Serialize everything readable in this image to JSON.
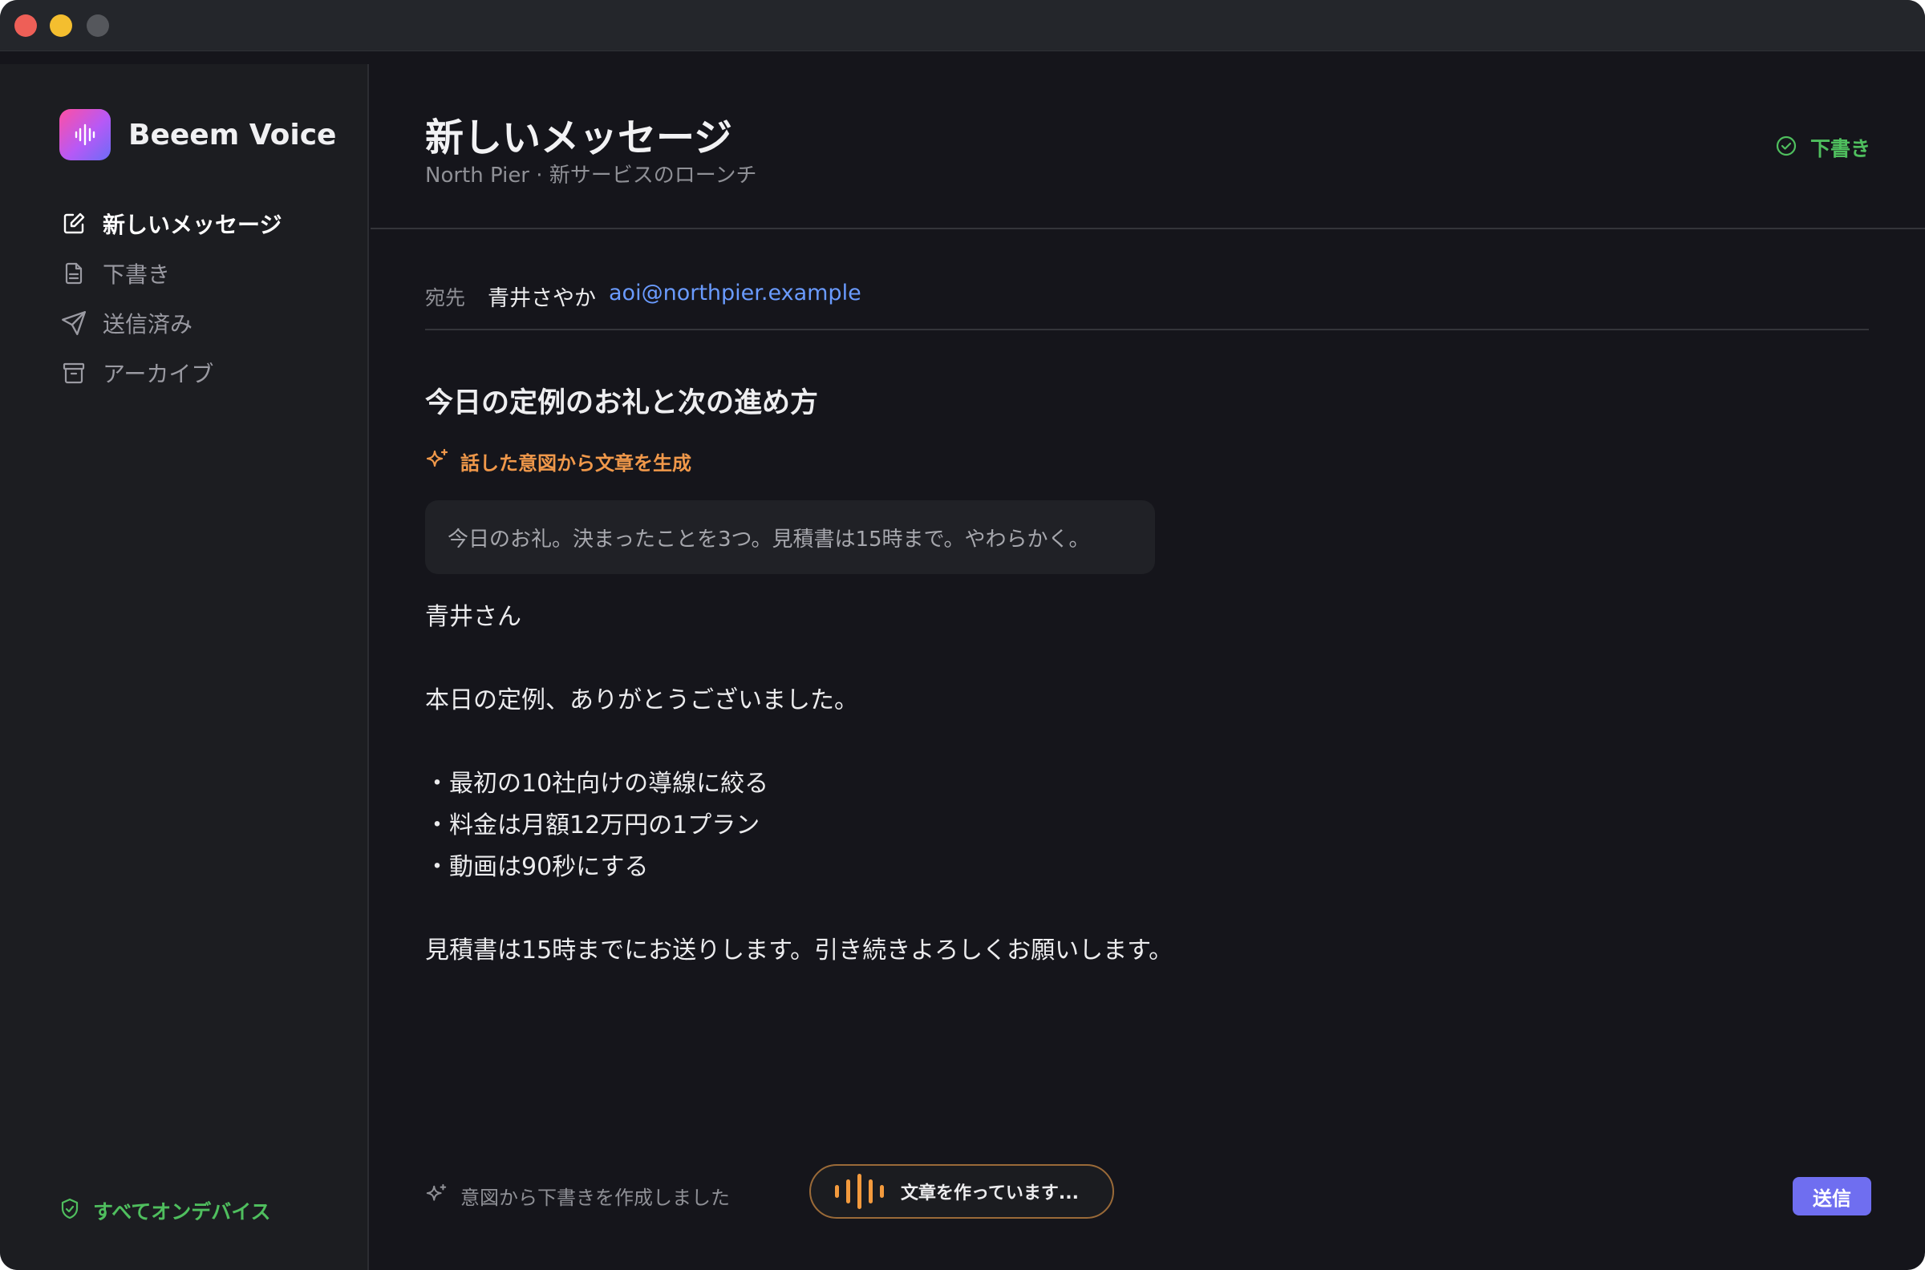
{
  "app": {
    "name": "Beeem Voice",
    "icon": "waveform-icon"
  },
  "sidebar": {
    "items": [
      {
        "label": "新しいメッセージ",
        "icon": "compose-icon",
        "active": true
      },
      {
        "label": "下書き",
        "icon": "document-icon",
        "active": false
      },
      {
        "label": "送信済み",
        "icon": "send-icon",
        "active": false
      },
      {
        "label": "アーカイブ",
        "icon": "archive-icon",
        "active": false
      }
    ],
    "footer": {
      "label": "すべてオンデバイス",
      "icon": "shield-check-icon"
    }
  },
  "header": {
    "title": "新しいメッセージ",
    "subtitle": "North Pier · 新サービスのローンチ",
    "status": {
      "label": "下書き",
      "icon": "check-circle-icon"
    }
  },
  "compose": {
    "to_label": "宛先",
    "to_name": "青井さやか",
    "to_email": "aoi@northpier.example",
    "subject": "今日の定例のお礼と次の進め方",
    "generate_label": "話した意図から文章を生成",
    "intent": "今日のお礼。決まったことを3つ。見積書は15時まで。やわらかく。",
    "body": {
      "greeting": "青井さん",
      "line1": "本日の定例、ありがとうございました。",
      "bullet1": "・最初の10社向けの導線に絞る",
      "bullet2": "・料金は月額12万円の1プラン",
      "bullet3": "・動画は90秒にする",
      "closing": "見積書は15時までにお送りします。引き続きよろしくお願いします。"
    }
  },
  "footer": {
    "note": "意図から下書きを作成しました",
    "recording_label": "文章を作っています...",
    "send_label": "送信"
  },
  "colors": {
    "accent": "#6f6ef0",
    "success": "#4fbf5e",
    "orange": "#f0984a",
    "link": "#6a9bff"
  }
}
